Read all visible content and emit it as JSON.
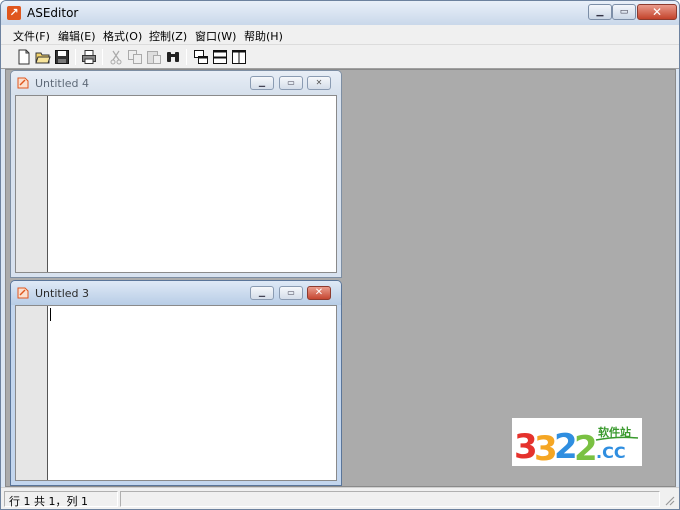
{
  "window": {
    "title": "ASEditor"
  },
  "menu": [
    "文件(F)",
    "编辑(E)",
    "格式(O)",
    "控制(Z)",
    "窗口(W)",
    "帮助(H)"
  ],
  "toolbar": [
    "new-file-icon",
    "open-folder-icon",
    "save-icon",
    "print-icon",
    "cut-icon",
    "copy-icon",
    "paste-icon",
    "find-icon",
    "cascade-windows-icon",
    "tile-horizontal-icon",
    "tile-vertical-icon"
  ],
  "documents": [
    {
      "title": "Untitled 4",
      "active": false
    },
    {
      "title": "Untitled 3",
      "active": true
    }
  ],
  "status": {
    "position": "行 1 共 1，列 1"
  },
  "watermark": {
    "text": "3322软件站 .CC",
    "colors": [
      "#e5322d",
      "#f5a623",
      "#2f8ee0",
      "#7ac142"
    ]
  },
  "colors": {
    "mdi_background": "#ababab",
    "close_red": "#c3432b",
    "app_icon": "#e0561d"
  }
}
